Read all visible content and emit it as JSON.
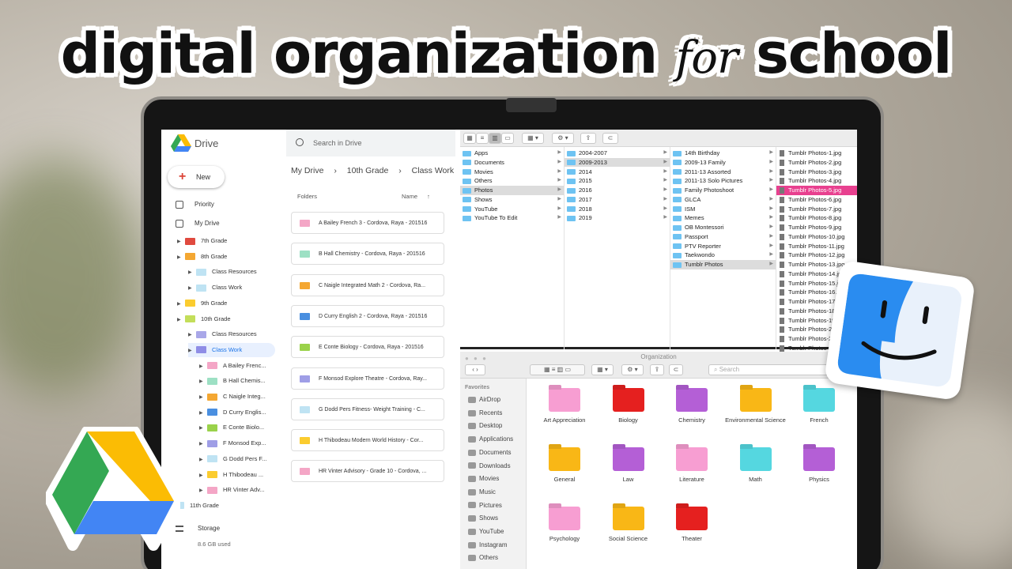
{
  "headline": {
    "part1": "digital organization",
    "script": "for",
    "part2": "school"
  },
  "drive": {
    "app_name": "Drive",
    "new_label": "New",
    "nav": [
      "Priority",
      "My Drive"
    ],
    "tree": [
      {
        "label": "7th Grade",
        "color": "#e04a3f",
        "indent": 1
      },
      {
        "label": "8th Grade",
        "color": "#f4a732",
        "indent": 1
      },
      {
        "label": "Class Resources",
        "color": "#bfe3f3",
        "indent": 2
      },
      {
        "label": "Class Work",
        "color": "#bfe3f3",
        "indent": 2
      },
      {
        "label": "9th Grade",
        "color": "#fbcc2f",
        "indent": 1
      },
      {
        "label": "10th Grade",
        "color": "#c3de5a",
        "indent": 1
      },
      {
        "label": "Class Resources",
        "color": "#a9a7e8",
        "indent": 2
      },
      {
        "label": "Class Work",
        "color": "#8f8de6",
        "indent": 2,
        "selected": true
      },
      {
        "label": "A Bailey Frenc...",
        "color": "#f4a6c6",
        "indent": 3
      },
      {
        "label": "B Hall Chemis...",
        "color": "#9de0c4",
        "indent": 3
      },
      {
        "label": "C Naigle Integ...",
        "color": "#f4a732",
        "indent": 3
      },
      {
        "label": "D Curry Englis...",
        "color": "#4a8fe0",
        "indent": 3
      },
      {
        "label": "E Conte Biolo...",
        "color": "#9ad24a",
        "indent": 3
      },
      {
        "label": "F Monsod Exp...",
        "color": "#9f9ee6",
        "indent": 3
      },
      {
        "label": "G Dodd Pers F...",
        "color": "#bfe3f3",
        "indent": 3
      },
      {
        "label": "H Thibodeau ...",
        "color": "#fbcc2f",
        "indent": 3
      },
      {
        "label": "HR Vinter Adv...",
        "color": "#f4a6c6",
        "indent": 3
      },
      {
        "label": "11th Grade",
        "color": "#bfe3f3",
        "indent": 0
      }
    ],
    "storage_label": "Storage",
    "storage_used": "8.6 GB used",
    "search_placeholder": "Search in Drive",
    "breadcrumb": [
      "My Drive",
      "›",
      "10th Grade",
      "›",
      "Class Work"
    ],
    "folders_label": "Folders",
    "name_label": "Name",
    "cards": [
      {
        "label": "A Bailey French 3 - Cordova, Raya - 201516",
        "color": "#f4a6c6"
      },
      {
        "label": "B Hall Chemistry - Cordova, Raya - 201516",
        "color": "#9de0c4"
      },
      {
        "label": "C Naigle Integrated Math 2 - Cordova, Ra...",
        "color": "#f4a732"
      },
      {
        "label": "D Curry English 2 - Cordova, Raya - 201516",
        "color": "#4a8fe0"
      },
      {
        "label": "E Conte Biology - Cordova, Raya - 201516",
        "color": "#9ad24a"
      },
      {
        "label": "F Monsod Explore Theatre - Cordova, Ray...",
        "color": "#9f9ee6"
      },
      {
        "label": "G Dodd Pers Fitness- Weight Training - C...",
        "color": "#bfe3f3"
      },
      {
        "label": "H Thibodeau Modern World History - Cor...",
        "color": "#fbcc2f"
      },
      {
        "label": "HR Vinter Advisory - Grade 10 - Cordova, ...",
        "color": "#f4a6c6"
      }
    ]
  },
  "finder_top": {
    "col1": [
      {
        "label": "Apps"
      },
      {
        "label": "Documents"
      },
      {
        "label": "Movies"
      },
      {
        "label": "Others"
      },
      {
        "label": "Photos",
        "selected": true
      },
      {
        "label": "Shows"
      },
      {
        "label": "YouTube"
      },
      {
        "label": "YouTube To Edit"
      }
    ],
    "col2": [
      {
        "label": "2004-2007"
      },
      {
        "label": "2009-2013",
        "selected": true
      },
      {
        "label": "2014"
      },
      {
        "label": "2015"
      },
      {
        "label": "2016"
      },
      {
        "label": "2017"
      },
      {
        "label": "2018"
      },
      {
        "label": "2019"
      }
    ],
    "col3": [
      {
        "label": "14th Birthday"
      },
      {
        "label": "2009-13 Family"
      },
      {
        "label": "2011-13 Assorted"
      },
      {
        "label": "2011-13 Solo Pictures"
      },
      {
        "label": "Family Photoshoot"
      },
      {
        "label": "GLCA"
      },
      {
        "label": "ISM"
      },
      {
        "label": "Memes"
      },
      {
        "label": "OB Montessori"
      },
      {
        "label": "Passport"
      },
      {
        "label": "PTV Reporter"
      },
      {
        "label": "Taekwondo"
      },
      {
        "label": "Tumblr Photos",
        "selected": true
      }
    ],
    "col4": [
      {
        "label": "Tumblr Photos-1.jpg"
      },
      {
        "label": "Tumblr Photos-2.jpg"
      },
      {
        "label": "Tumblr Photos-3.jpg"
      },
      {
        "label": "Tumblr Photos-4.jpg"
      },
      {
        "label": "Tumblr Photos-5.jpg",
        "highlight": true
      },
      {
        "label": "Tumblr Photos-6.jpg"
      },
      {
        "label": "Tumblr Photos-7.jpg"
      },
      {
        "label": "Tumblr Photos-8.jpg"
      },
      {
        "label": "Tumblr Photos-9.jpg"
      },
      {
        "label": "Tumblr Photos-10.jpg"
      },
      {
        "label": "Tumblr Photos-11.jpg"
      },
      {
        "label": "Tumblr Photos-12.jpg"
      },
      {
        "label": "Tumblr Photos-13.jpg"
      },
      {
        "label": "Tumblr Photos-14.jpg"
      },
      {
        "label": "Tumblr Photos-15.jpg"
      },
      {
        "label": "Tumblr Photos-16.jpg"
      },
      {
        "label": "Tumblr Photos-17.jpg"
      },
      {
        "label": "Tumblr Photos-18.jpg"
      },
      {
        "label": "Tumblr Photos-19.jpg"
      },
      {
        "label": "Tumblr Photos-2"
      },
      {
        "label": "Tumblr Photos-2"
      },
      {
        "label": "Tumblr Photos"
      }
    ]
  },
  "finder_bottom": {
    "window_title": "Organization",
    "search_placeholder": "Search",
    "favorites_label": "Favorites",
    "sidebar": [
      "AirDrop",
      "Recents",
      "Desktop",
      "Applications",
      "Documents",
      "Downloads",
      "Movies",
      "Music",
      "Pictures",
      "Shows",
      "YouTube",
      "Instagram",
      "Others"
    ],
    "folders": [
      {
        "label": "Art Appreciation",
        "color": "#f79ed2"
      },
      {
        "label": "Biology",
        "color": "#e5201f"
      },
      {
        "label": "Chemistry",
        "color": "#b45fd6"
      },
      {
        "label": "Environmental Science",
        "color": "#f9b716"
      },
      {
        "label": "French",
        "color": "#55d7e0"
      },
      {
        "label": "General",
        "color": "#f9b716"
      },
      {
        "label": "Law",
        "color": "#b45fd6"
      },
      {
        "label": "Literature",
        "color": "#f79ed2"
      },
      {
        "label": "Math",
        "color": "#55d7e0"
      },
      {
        "label": "Physics",
        "color": "#b45fd6"
      },
      {
        "label": "Psychology",
        "color": "#f79ed2"
      },
      {
        "label": "Social Science",
        "color": "#f9b716"
      },
      {
        "label": "Theater",
        "color": "#e5201f"
      }
    ]
  }
}
